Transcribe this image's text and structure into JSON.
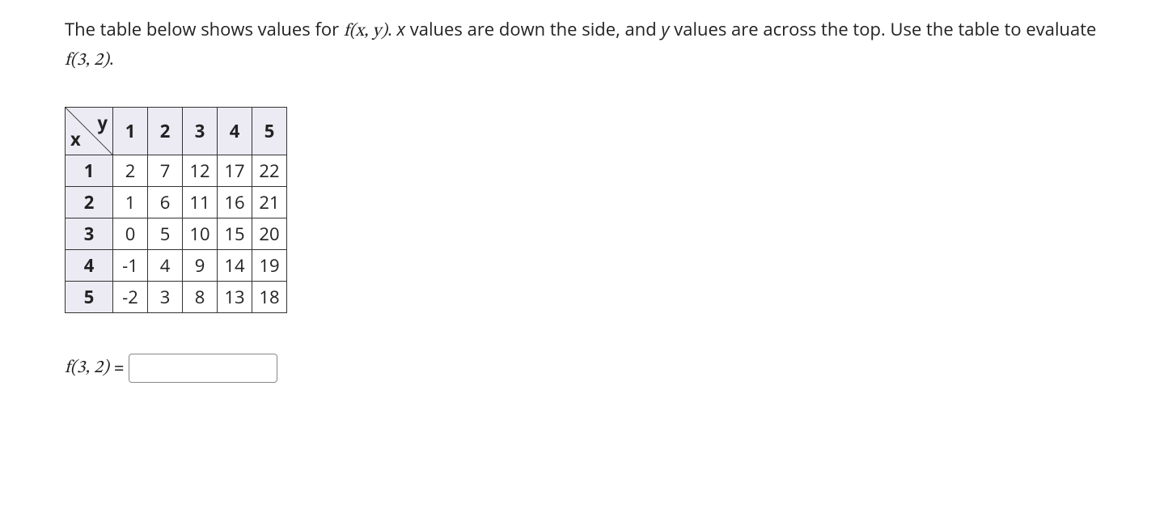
{
  "prompt": {
    "p1": "The table below shows values for ",
    "fxy": "f(x, y)",
    "p2": ". ",
    "xvar": "x",
    "p3": " values are down the side, and ",
    "yvar": "y",
    "p4": " values are across the top. Use the table to evaluate ",
    "f32": "f(3, 2)",
    "p5": "."
  },
  "table": {
    "corner_x": "x",
    "corner_y": "y",
    "y_headers": [
      "1",
      "2",
      "3",
      "4",
      "5"
    ],
    "rows": [
      {
        "x": "1",
        "cells": [
          "2",
          "7",
          "12",
          "17",
          "22"
        ]
      },
      {
        "x": "2",
        "cells": [
          "1",
          "6",
          "11",
          "16",
          "21"
        ]
      },
      {
        "x": "3",
        "cells": [
          "0",
          "5",
          "10",
          "15",
          "20"
        ]
      },
      {
        "x": "4",
        "cells": [
          "-1",
          "4",
          "9",
          "14",
          "19"
        ]
      },
      {
        "x": "5",
        "cells": [
          "-2",
          "3",
          "8",
          "13",
          "18"
        ]
      }
    ]
  },
  "answer": {
    "label": "f(3, 2)",
    "equals": " = ",
    "value": "",
    "placeholder": ""
  }
}
